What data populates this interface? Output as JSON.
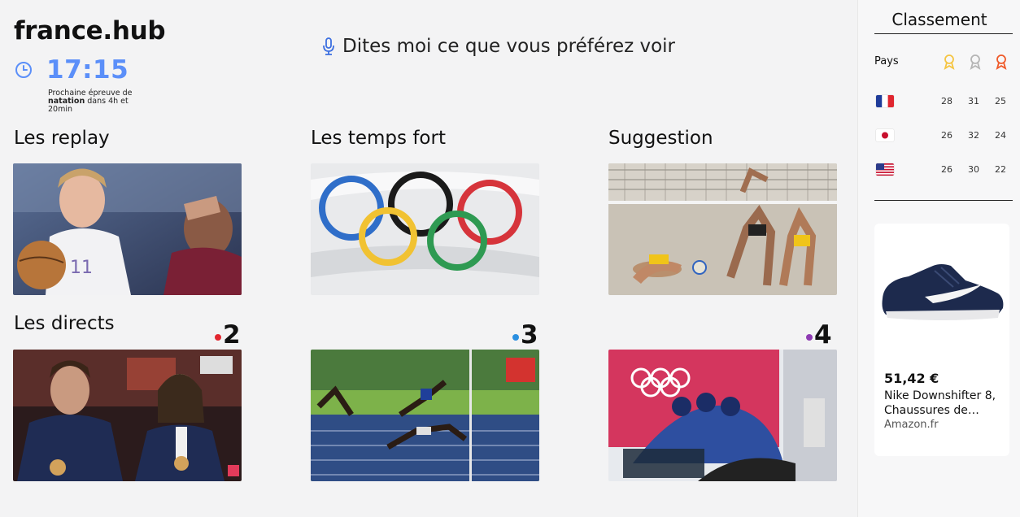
{
  "header": {
    "brand": "france.hub",
    "time": "17:15",
    "next_event_prefix": "Prochaine épreuve de",
    "next_event_sport": "natation",
    "next_event_suffix": "dans 4h et 20min",
    "voice_prompt": "Dites moi ce que vous préférez voir"
  },
  "sections": {
    "replay": "Les replay",
    "highlights": "Les temps fort",
    "suggestion": "Suggestion",
    "live": "Les directs"
  },
  "channels": [
    {
      "number": "2",
      "color": "#e2262f"
    },
    {
      "number": "3",
      "color": "#2a8fe0"
    },
    {
      "number": "4",
      "color": "#8e3ab3"
    }
  ],
  "ranking": {
    "title": "Classement",
    "country_header": "Pays",
    "medal_colors": [
      "#f5c542",
      "#b5b5b5",
      "#ef5a2a"
    ],
    "rows": [
      {
        "country": "france",
        "gold": "28",
        "silver": "31",
        "bronze": "25"
      },
      {
        "country": "japan",
        "gold": "26",
        "silver": "32",
        "bronze": "24"
      },
      {
        "country": "usa",
        "gold": "26",
        "silver": "30",
        "bronze": "22"
      }
    ]
  },
  "ad": {
    "price": "51,42 €",
    "product": "Nike Downshifter 8, Chaussures de…",
    "store": "Amazon.fr"
  },
  "icons": [
    "clock-icon",
    "microphone-icon",
    "medal-icon"
  ],
  "colors": {
    "accent": "#5b8ff9"
  }
}
